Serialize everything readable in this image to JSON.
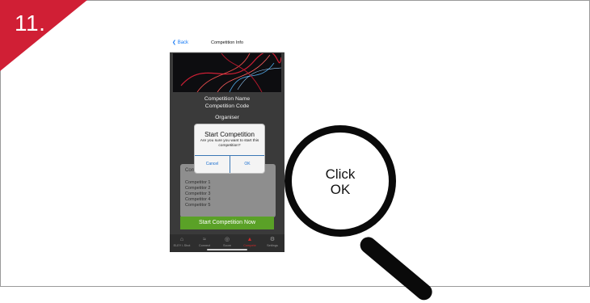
{
  "step_label": "11.",
  "app": {
    "nav": {
      "back_label": "Back",
      "title": "Competition Info"
    },
    "info": {
      "competition_name": "Competition Name",
      "competition_code": "Competition Code",
      "organiser": "Organiser"
    },
    "competitors_header": "Comp",
    "competitors": [
      "Competitor 1",
      "Competitor 2",
      "Competitor 3",
      "Competitor 4",
      "Competitor 5"
    ],
    "start_button": "Start Competition Now",
    "tabs": [
      {
        "label": "ELEY I-Shot",
        "icon": "home-icon",
        "active": false
      },
      {
        "label": "Connect",
        "icon": "wifi-icon",
        "active": false
      },
      {
        "label": "Score",
        "icon": "target-icon",
        "active": false
      },
      {
        "label": "Compete",
        "icon": "trophy-icon",
        "active": true
      },
      {
        "label": "Settings",
        "icon": "gear-icon",
        "active": false
      }
    ]
  },
  "dialog": {
    "title": "Start Competition",
    "message": "Are you sure you want to start this competition?",
    "cancel_label": "Cancel",
    "ok_label": "OK"
  },
  "callout": {
    "line1": "Click",
    "line2": "OK"
  },
  "colors": {
    "accent_red": "#d01f35",
    "start_green": "#5aa127",
    "link_blue": "#1a7cf5"
  }
}
